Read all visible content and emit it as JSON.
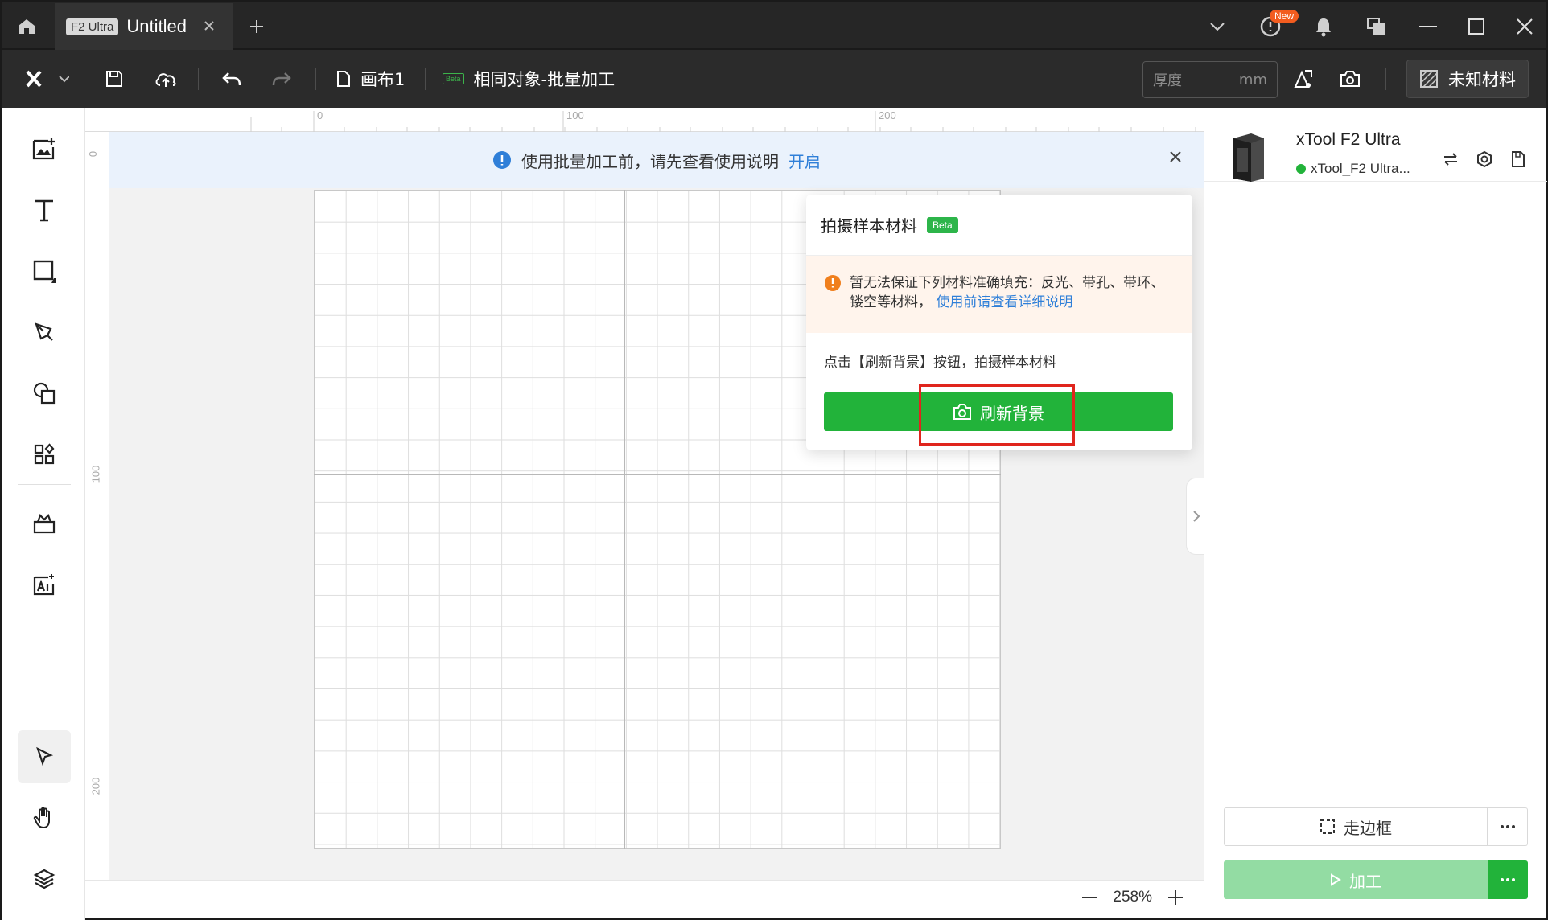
{
  "titlebar": {
    "tab_badge": "F2 Ultra",
    "tab_title": "Untitled",
    "new_badge": "New"
  },
  "toolbar": {
    "canvas_name": "画布1",
    "batch_beta": "Beta",
    "batch_label": "相同对象-批量加工",
    "thickness_placeholder": "厚度",
    "thickness_unit": "mm",
    "material_label": "未知材料"
  },
  "ruler": {
    "top_labels": [
      "0",
      "100",
      "200"
    ],
    "left_labels": [
      "0",
      "100",
      "200"
    ]
  },
  "banner": {
    "text": "使用批量加工前，请先查看使用说明",
    "link": "开启"
  },
  "popup": {
    "title": "拍摄样本材料",
    "beta": "Beta",
    "warning_text": "暂无法保证下列材料准确填充：反光、带孔、带环、镂空等材料，",
    "warning_link": "使用前请查看详细说明",
    "hint": "点击【刷新背景】按钮，拍摄样本材料",
    "refresh_label": "刷新背景"
  },
  "device": {
    "name": "xTool F2 Ultra",
    "status": "xTool_F2 Ultra..."
  },
  "actions": {
    "frame_label": "走边框",
    "process_label": "加工"
  },
  "zoom": {
    "level": "258%"
  },
  "colors": {
    "accent_green": "#22b33a",
    "link_blue": "#2f7fd8",
    "highlight_red": "#e0251d"
  }
}
